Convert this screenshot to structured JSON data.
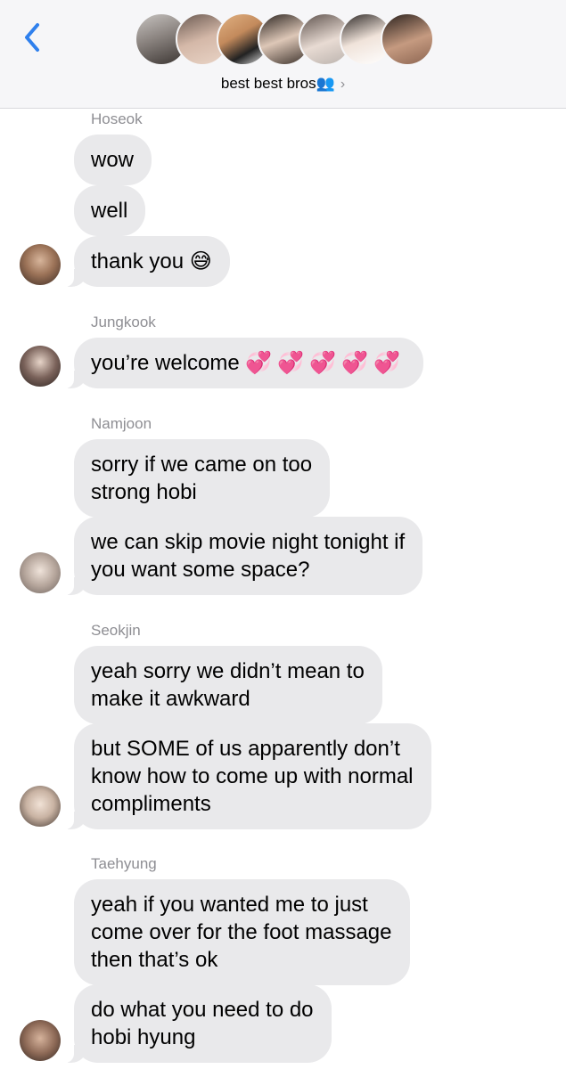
{
  "header": {
    "group_name": "best best bros",
    "group_emoji": "👥",
    "chevron": "›",
    "back_icon": "chevron-left-icon",
    "accent_color": "#2f80ed",
    "member_avatars": [
      "avatar-1",
      "avatar-2",
      "avatar-3",
      "avatar-4",
      "avatar-5",
      "avatar-6",
      "avatar-7"
    ]
  },
  "messages": {
    "hoseok": {
      "sender": "Hoseok",
      "bubbles": [
        "wow",
        "well",
        "thank you",
        "😅"
      ]
    },
    "jungkook": {
      "sender": "Jungkook",
      "bubble": "you’re welcome",
      "hearts": "💞💞💞💞💞"
    },
    "namjoon": {
      "sender": "Namjoon",
      "bubbles": [
        [
          "sorry if we came on too",
          "strong hobi"
        ],
        [
          "we can skip movie night tonight if",
          "you want some space?"
        ]
      ]
    },
    "seokjin": {
      "sender": "Seokjin",
      "bubbles": [
        [
          "yeah sorry we didn’t mean to",
          "make it awkward"
        ],
        [
          "but SOME of us apparently don’t",
          "know how to come up with normal",
          "compliments"
        ]
      ]
    },
    "taehyung": {
      "sender": "Taehyung",
      "bubbles": [
        [
          "yeah if you wanted me to just",
          "come over for the foot massage",
          "then that’s ok"
        ],
        [
          "do what you need to do",
          "hobi hyung"
        ]
      ]
    }
  },
  "colors": {
    "bubble": "#e9e9eb",
    "sender_label": "#8e8e93",
    "header_bg": "#f6f6f8"
  }
}
